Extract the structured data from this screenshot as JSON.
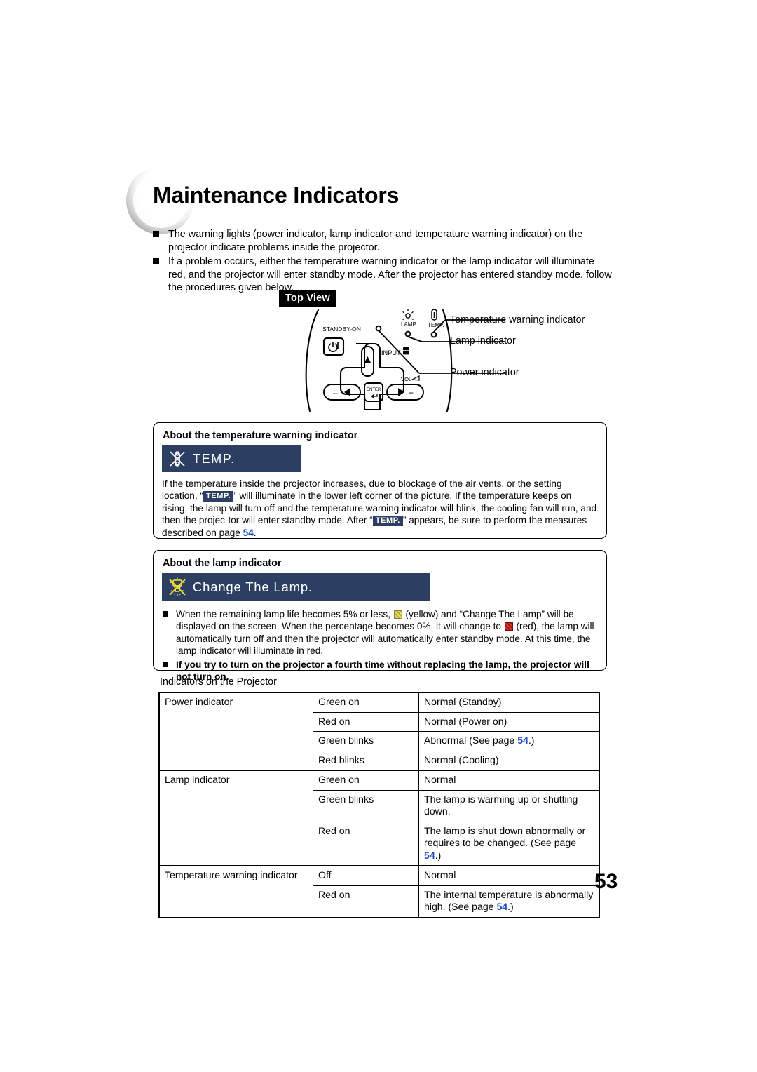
{
  "document": {
    "title": "Maintenance Indicators",
    "page_number": "53"
  },
  "intro": {
    "bullets": [
      "The warning lights (power indicator, lamp indicator and temperature warning indicator) on the projector indicate problems inside the projector.",
      "If a problem occurs, either the temperature warning indicator or the lamp indicator will illuminate red, and the projector will enter standby mode. After the projector has entered standby mode, follow the procedures given below."
    ]
  },
  "diagram": {
    "label": "Top View",
    "control_labels": {
      "standby_on": "STANDBY-ON",
      "lamp": "LAMP",
      "temp": "TEMP.",
      "input": "INPUT",
      "vol": "VOL",
      "enter": "ENTER",
      "minus": "–",
      "plus": "+"
    },
    "callouts": [
      "Temperature warning indicator",
      "Lamp indicator",
      "Power indicator"
    ]
  },
  "temp_section": {
    "heading": "About the temperature warning indicator",
    "osd_banner_text": "TEMP.",
    "body_part1": "If the temperature inside the projector increases, due to blockage of the air vents, or the setting location, “",
    "badge1": "TEMP.",
    "body_part2": "” will illuminate in the lower left corner of the picture. If the temperature keeps on rising, the lamp will turn off and the temperature warning indicator will blink, the cooling fan will run, and then the projec-tor will enter standby mode. After “",
    "badge2": "TEMP.",
    "body_part3": "” appears, be sure to perform the measures described on page ",
    "page_ref": "54",
    "body_part4": "."
  },
  "lamp_section": {
    "heading": "About the lamp indicator",
    "osd_banner_text": "Change The Lamp.",
    "bullet1_part1": "When the remaining lamp life becomes 5% or less, ",
    "bullet1_part2": " (yellow) and “Change The Lamp” will be displayed on the screen. When the percentage becomes 0%, it will change to ",
    "bullet1_part3": " (red), the lamp will automatically turn off and then the projector will automatically enter standby mode. At this time, the lamp indicator will illuminate in red.",
    "bullet2": "If you try to turn on the projector a fourth time without replacing the lamp, the projector will not turn on."
  },
  "table": {
    "caption": "Indicators on the Projector",
    "rows": [
      {
        "indicator": "Power indicator",
        "state": "Green on",
        "meaning": "Normal (Standby)",
        "page_ref": "",
        "meaning_suffix": ""
      },
      {
        "indicator": "",
        "state": "Red on",
        "meaning": "Normal (Power on)",
        "page_ref": "",
        "meaning_suffix": ""
      },
      {
        "indicator": "",
        "state": "Green blinks",
        "meaning": "Abnormal (See page ",
        "page_ref": "54",
        "meaning_suffix": ".)"
      },
      {
        "indicator": "",
        "state": "Red blinks",
        "meaning": "Normal (Cooling)",
        "page_ref": "",
        "meaning_suffix": ""
      },
      {
        "indicator": "Lamp indicator",
        "state": "Green on",
        "meaning": "Normal",
        "page_ref": "",
        "meaning_suffix": ""
      },
      {
        "indicator": "",
        "state": "Green blinks",
        "meaning": "The lamp is warming up or shutting down.",
        "page_ref": "",
        "meaning_suffix": ""
      },
      {
        "indicator": "",
        "state": "Red on",
        "meaning": "The lamp is shut down abnormally or requires to be changed. (See page ",
        "page_ref": "54",
        "meaning_suffix": ".)"
      },
      {
        "indicator": "Temperature warning indicator",
        "state": "Off",
        "meaning": "Normal",
        "page_ref": "",
        "meaning_suffix": ""
      },
      {
        "indicator": "",
        "state": "Red on",
        "meaning": "The internal temperature is abnormally high. (See page ",
        "page_ref": "54",
        "meaning_suffix": ".)"
      }
    ]
  },
  "colors": {
    "osd_background": "#2c3f63",
    "page_link": "#1b4ec8",
    "lamp_icon_yellow": "#e8dc6a",
    "warning_red": "#e03a2c"
  }
}
